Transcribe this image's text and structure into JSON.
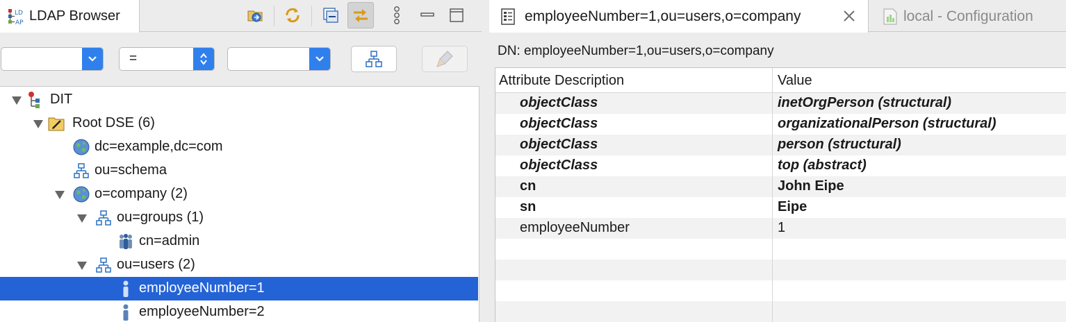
{
  "left_panel": {
    "tab_title": "LDAP Browser",
    "toolbar": {
      "link_with_editor": "link-with-editor-icon",
      "refresh": "refresh-icon",
      "collapse_all": "collapse-all-icon",
      "sync": "sync-icon",
      "view_menu": "view-menu-icon",
      "minimize": "minimize-icon",
      "maximize": "maximize-icon"
    },
    "filter": {
      "attribute_value": "",
      "operator_value": "=",
      "value_value": ""
    },
    "tree": [
      {
        "label": "DIT",
        "icon": "dit-icon",
        "expanded": true
      },
      {
        "label": "Root DSE (6)",
        "icon": "root-dse-icon",
        "expanded": true
      },
      {
        "label": "dc=example,dc=com",
        "icon": "globe-icon"
      },
      {
        "label": "ou=schema",
        "icon": "org-unit-icon"
      },
      {
        "label": "o=company (2)",
        "icon": "globe-icon",
        "expanded": true
      },
      {
        "label": "ou=groups (1)",
        "icon": "org-unit-icon",
        "expanded": true
      },
      {
        "label": "cn=admin",
        "icon": "group-icon"
      },
      {
        "label": "ou=users (2)",
        "icon": "org-unit-icon",
        "expanded": true
      },
      {
        "label": "employeeNumber=1",
        "icon": "person-icon",
        "selected": true
      },
      {
        "label": "employeeNumber=2",
        "icon": "person-icon"
      }
    ]
  },
  "editor": {
    "tabs": [
      {
        "label": "employeeNumber=1,ou=users,o=company",
        "active": true
      },
      {
        "label": "local - Configuration",
        "active": false
      }
    ],
    "dn_label": "DN: employeeNumber=1,ou=users,o=company",
    "columns": [
      "Attribute Description",
      "Value"
    ],
    "rows": [
      {
        "attribute": "objectClass",
        "value": "inetOrgPerson (structural)",
        "style": "objectclass"
      },
      {
        "attribute": "objectClass",
        "value": "organizationalPerson (structural)",
        "style": "objectclass"
      },
      {
        "attribute": "objectClass",
        "value": "person (structural)",
        "style": "objectclass"
      },
      {
        "attribute": "objectClass",
        "value": "top (abstract)",
        "style": "objectclass"
      },
      {
        "attribute": "cn",
        "value": "John Eipe",
        "style": "must"
      },
      {
        "attribute": "sn",
        "value": "Eipe",
        "style": "must"
      },
      {
        "attribute": "employeeNumber",
        "value": "1",
        "style": "may"
      }
    ]
  },
  "colors": {
    "selection": "#2463d6",
    "combo_arrow": "#2f80ed",
    "row_alt": "#f2f2f2"
  }
}
